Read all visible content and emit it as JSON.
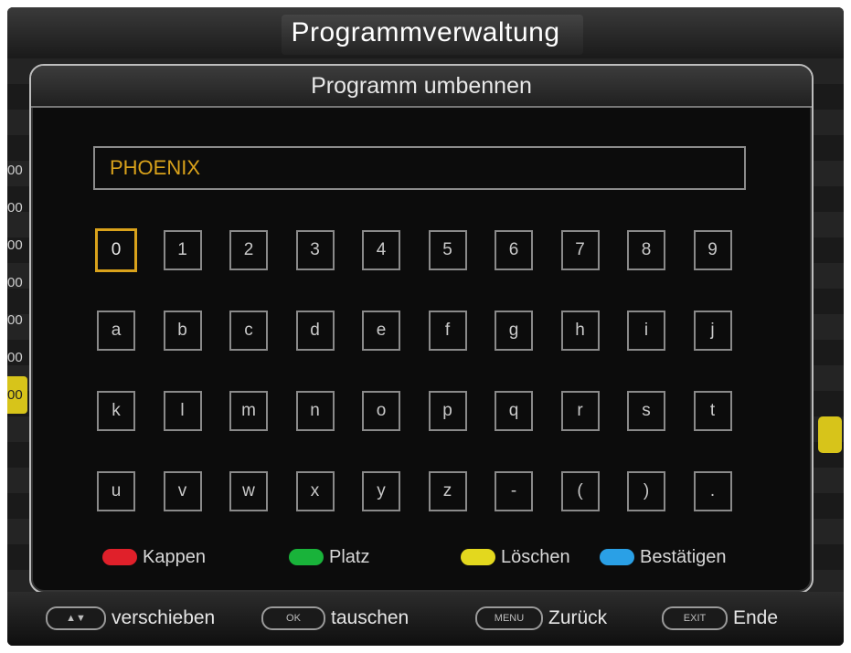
{
  "header": {
    "title": "Programmverwaltung"
  },
  "background": {
    "left_values": [
      "00",
      "00",
      "00",
      "00",
      "00",
      "00",
      "00"
    ]
  },
  "dialog": {
    "title": "Programm umbennen",
    "name_value": "PHOENIX",
    "keyboard": {
      "rows": [
        [
          "0",
          "1",
          "2",
          "3",
          "4",
          "5",
          "6",
          "7",
          "8",
          "9"
        ],
        [
          "a",
          "b",
          "c",
          "d",
          "e",
          "f",
          "g",
          "h",
          "i",
          "j"
        ],
        [
          "k",
          "l",
          "m",
          "n",
          "o",
          "p",
          "q",
          "r",
          "s",
          "t"
        ],
        [
          "u",
          "v",
          "w",
          "x",
          "y",
          "z",
          "-",
          "(",
          ")",
          "."
        ]
      ],
      "selected": "0"
    },
    "legend": [
      {
        "label": "Kappen",
        "color": "#e0202a"
      },
      {
        "label": "Platz",
        "color": "#19b33a"
      },
      {
        "label": "Löschen",
        "color": "#e3d81e"
      },
      {
        "label": "Bestätigen",
        "color": "#2aa0e6"
      }
    ]
  },
  "footer": {
    "items": [
      {
        "key": "▲▼",
        "label": "verschieben"
      },
      {
        "key": "OK",
        "label": "tauschen"
      },
      {
        "key": "MENU",
        "label": "Zurück"
      },
      {
        "key": "EXIT",
        "label": "Ende"
      }
    ]
  }
}
